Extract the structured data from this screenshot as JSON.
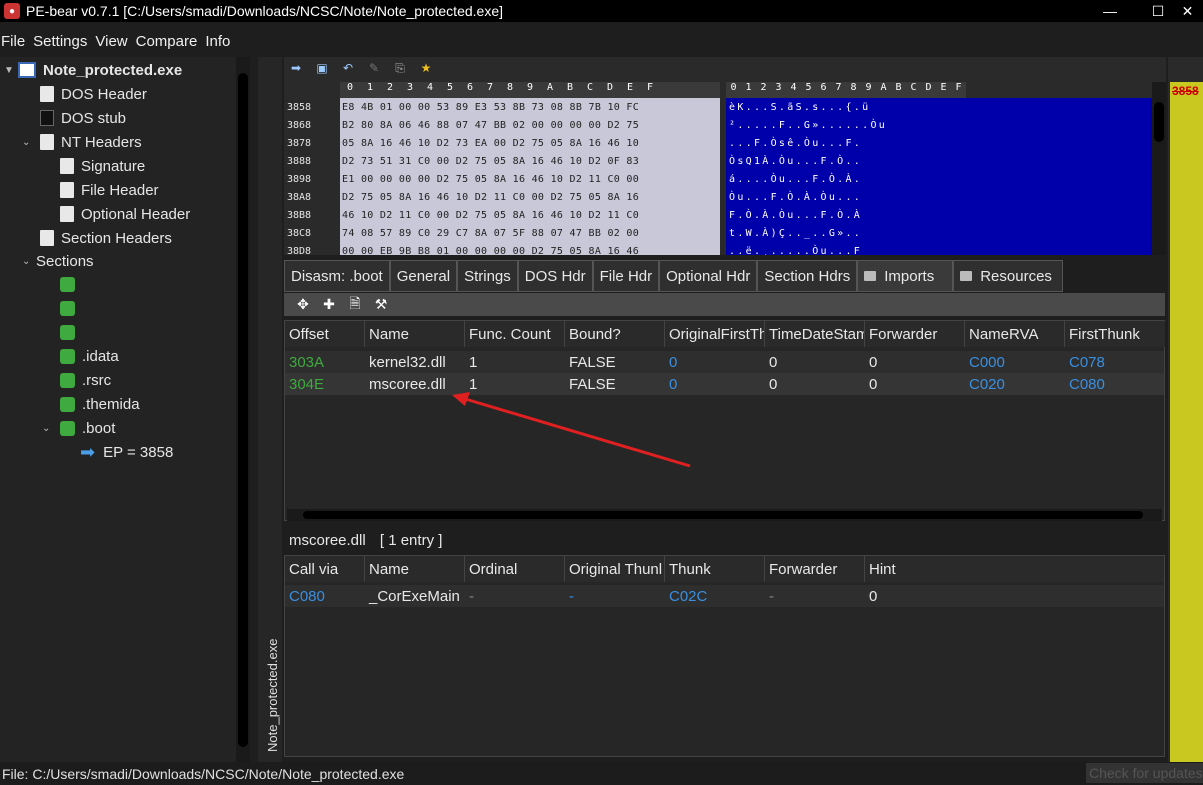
{
  "window": {
    "title": "PE-bear v0.7.1 [C:/Users/smadi/Downloads/NCSC/Note/Note_protected.exe]",
    "minimize": "—",
    "maximize": "☐",
    "close": "✕"
  },
  "menu": [
    "File",
    "Settings",
    "View",
    "Compare",
    "Info"
  ],
  "tree": {
    "root": "Note_protected.exe",
    "dos_header": "DOS Header",
    "dos_stub": "DOS stub",
    "nt_headers": "NT Headers",
    "signature": "Signature",
    "file_header": "File Header",
    "optional_header": "Optional Header",
    "section_headers": "Section Headers",
    "sections": "Sections",
    "section_items": [
      "",
      "",
      "",
      ".idata",
      ".rsrc",
      ".themida",
      ".boot"
    ],
    "ep": "EP = 3858"
  },
  "vertical_tab": "Note_protected.exe",
  "hex": {
    "columns": [
      "0",
      "1",
      "2",
      "3",
      "4",
      "5",
      "6",
      "7",
      "8",
      "9",
      "A",
      "B",
      "C",
      "D",
      "E",
      "F"
    ],
    "offsets": [
      "3858",
      "3868",
      "3878",
      "3888",
      "3898",
      "38A8",
      "38B8",
      "38C8",
      "38D8"
    ],
    "hex_rows": [
      "E8 4B 01 00 00 53 89 E3 53 8B 73 08 8B 7B 10 FC",
      "B2 80 8A 06 46 88 07 47 BB 02 00 00 00 00 D2 75",
      "05 8A 16 46 10 D2 73 EA 00 D2 75 05 8A 16 46 10",
      "D2 73 51 31 C0 00 D2 75 05 8A 16 46 10 D2 0F 83",
      "E1 00 00 00 00 D2 75 05 8A 16 46 10 D2 11 C0 00",
      "D2 75 05 8A 16 46 10 D2 11 C0 00 D2 75 05 8A 16",
      "46 10 D2 11 C0 00 D2 75 05 8A 16 46 10 D2 11 C0",
      "74 08 57 89 C0 29 C7 8A 07 5F 88 07 47 BB 02 00",
      "00 00 EB 9B B8 01 00 00 00 00 D2 75 05 8A 16 46"
    ],
    "ascii_rows": [
      "èK...S.ãS.s...{.ü",
      "².....F..G»......Òu",
      "...F.Òsê.Òu...F.",
      "ÒsQ1À.Òu...F.Ò..",
      "á....Òu...F.Ò.À.",
      "Òu...F.Ò.À.Òu...",
      "F.Ò.À.Òu...F.Ò.À",
      "t.W.À)Ç.._..G»..",
      "..ë.¸.....Òu...F"
    ]
  },
  "tabs": [
    "Disasm: .boot",
    "General",
    "Strings",
    "DOS Hdr",
    "File Hdr",
    "Optional Hdr",
    "Section Hdrs",
    "Imports",
    "Resources"
  ],
  "imports": {
    "headers": [
      "Offset",
      "Name",
      "Func. Count",
      "Bound?",
      "OriginalFirstTh",
      "TimeDateStam",
      "Forwarder",
      "NameRVA",
      "FirstThunk"
    ],
    "rows": [
      [
        "303A",
        "kernel32.dll",
        "1",
        "FALSE",
        "0",
        "0",
        "0",
        "C000",
        "C078"
      ],
      [
        "304E",
        "mscoree.dll",
        "1",
        "FALSE",
        "0",
        "0",
        "0",
        "C020",
        "C080"
      ]
    ]
  },
  "selected_dll": {
    "name": "mscoree.dll",
    "count": "[ 1 entry ]"
  },
  "functions": {
    "headers": [
      "Call via",
      "Name",
      "Ordinal",
      "Original Thunl",
      "Thunk",
      "Forwarder",
      "Hint"
    ],
    "rows": [
      [
        "C080",
        "_CorExeMain",
        "-",
        "-",
        "C02C",
        "-",
        "0"
      ]
    ]
  },
  "right_strip_label": "3858",
  "status": {
    "file": "File: C:/Users/smadi/Downloads/NCSC/Note/Note_protected.exe",
    "update": "Check for updates"
  },
  "colors": {
    "offset_green": "#3faa3f",
    "link_blue": "#3a8fe0",
    "ascii_bg": "#0000aa",
    "arrow_red": "#e02020"
  }
}
